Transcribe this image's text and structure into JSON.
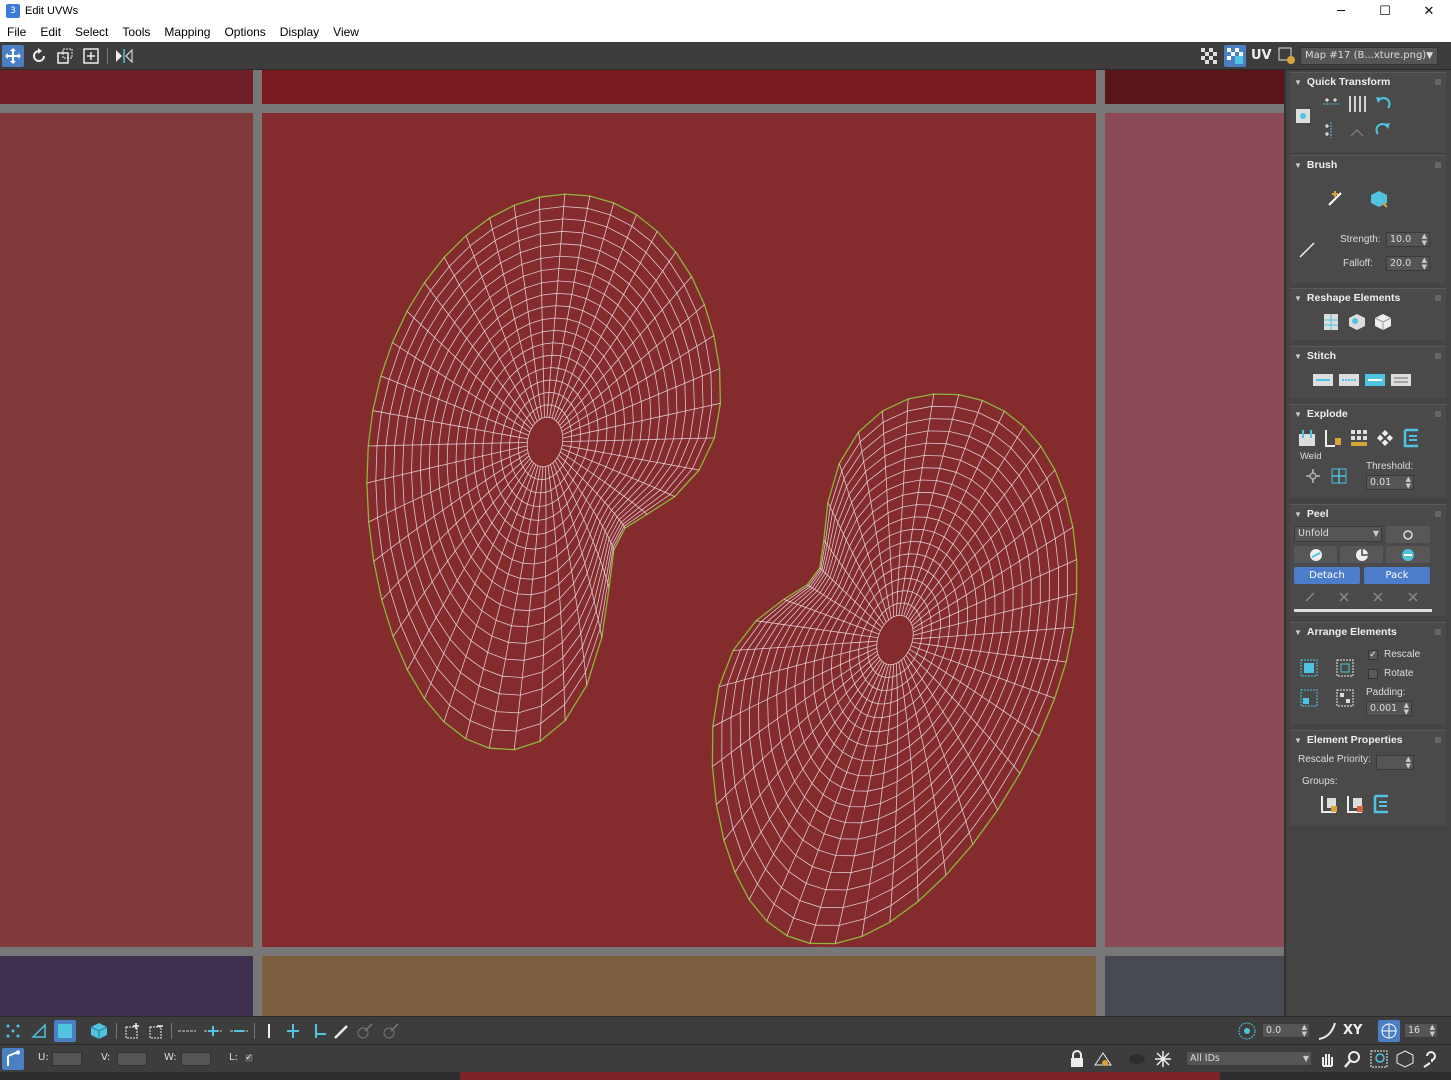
{
  "window": {
    "title": "Edit UVWs",
    "minimize": "─",
    "maximize": "☐",
    "close": "✕"
  },
  "menu": [
    "File",
    "Edit",
    "Select",
    "Tools",
    "Mapping",
    "Options",
    "Display",
    "View"
  ],
  "toolbar": {
    "uv_label": "UV",
    "map_select": "Map #17 (B...xture.png)",
    "icons": [
      "move-icon",
      "rotate-icon",
      "scale-icon",
      "freeform-icon",
      "mirror-icon"
    ]
  },
  "colors": {
    "tile_center": "#842b2e",
    "tile_top_center": "#7a1a1e",
    "tile_left": "#803a3b",
    "tile_right": "#8b4a56",
    "tile_bottom_center": "#7d5e3e",
    "tile_bottom_left": "#3f2f4f",
    "tile_bottom_right": "#474a50",
    "tile_top_left": "#701f28",
    "tile_top_right": "#5a1518",
    "grid_lines": "#7f7f7f",
    "mesh_edge": "#e8d8dc",
    "mesh_border": "#8fb53a",
    "accent": "#4b7fc4"
  },
  "panel": {
    "quick_transform": {
      "title": "Quick Transform"
    },
    "brush": {
      "title": "Brush",
      "strength_label": "Strength:",
      "strength": "10.0",
      "falloff_label": "Falloff:",
      "falloff": "20.0"
    },
    "reshape": {
      "title": "Reshape Elements"
    },
    "stitch": {
      "title": "Stitch"
    },
    "explode": {
      "title": "Explode",
      "weld_label": "Weld",
      "threshold_label": "Threshold:",
      "threshold": "0.01"
    },
    "peel": {
      "title": "Peel",
      "mode": "Unfold",
      "detach": "Detach",
      "pack": "Pack"
    },
    "arrange": {
      "title": "Arrange Elements",
      "rescale": "Rescale",
      "rotate": "Rotate",
      "padding_label": "Padding:",
      "padding": "0.001"
    },
    "element_props": {
      "title": "Element Properties",
      "rescale_priority": "Rescale Priority:",
      "groups": "Groups:"
    }
  },
  "bottom": {
    "angle": "0.0",
    "xy_label": "XY",
    "grid_count": "16",
    "u_label": "U:",
    "v_label": "V:",
    "w_label": "W:",
    "l_label": "L:",
    "ids_select": "All IDs"
  }
}
